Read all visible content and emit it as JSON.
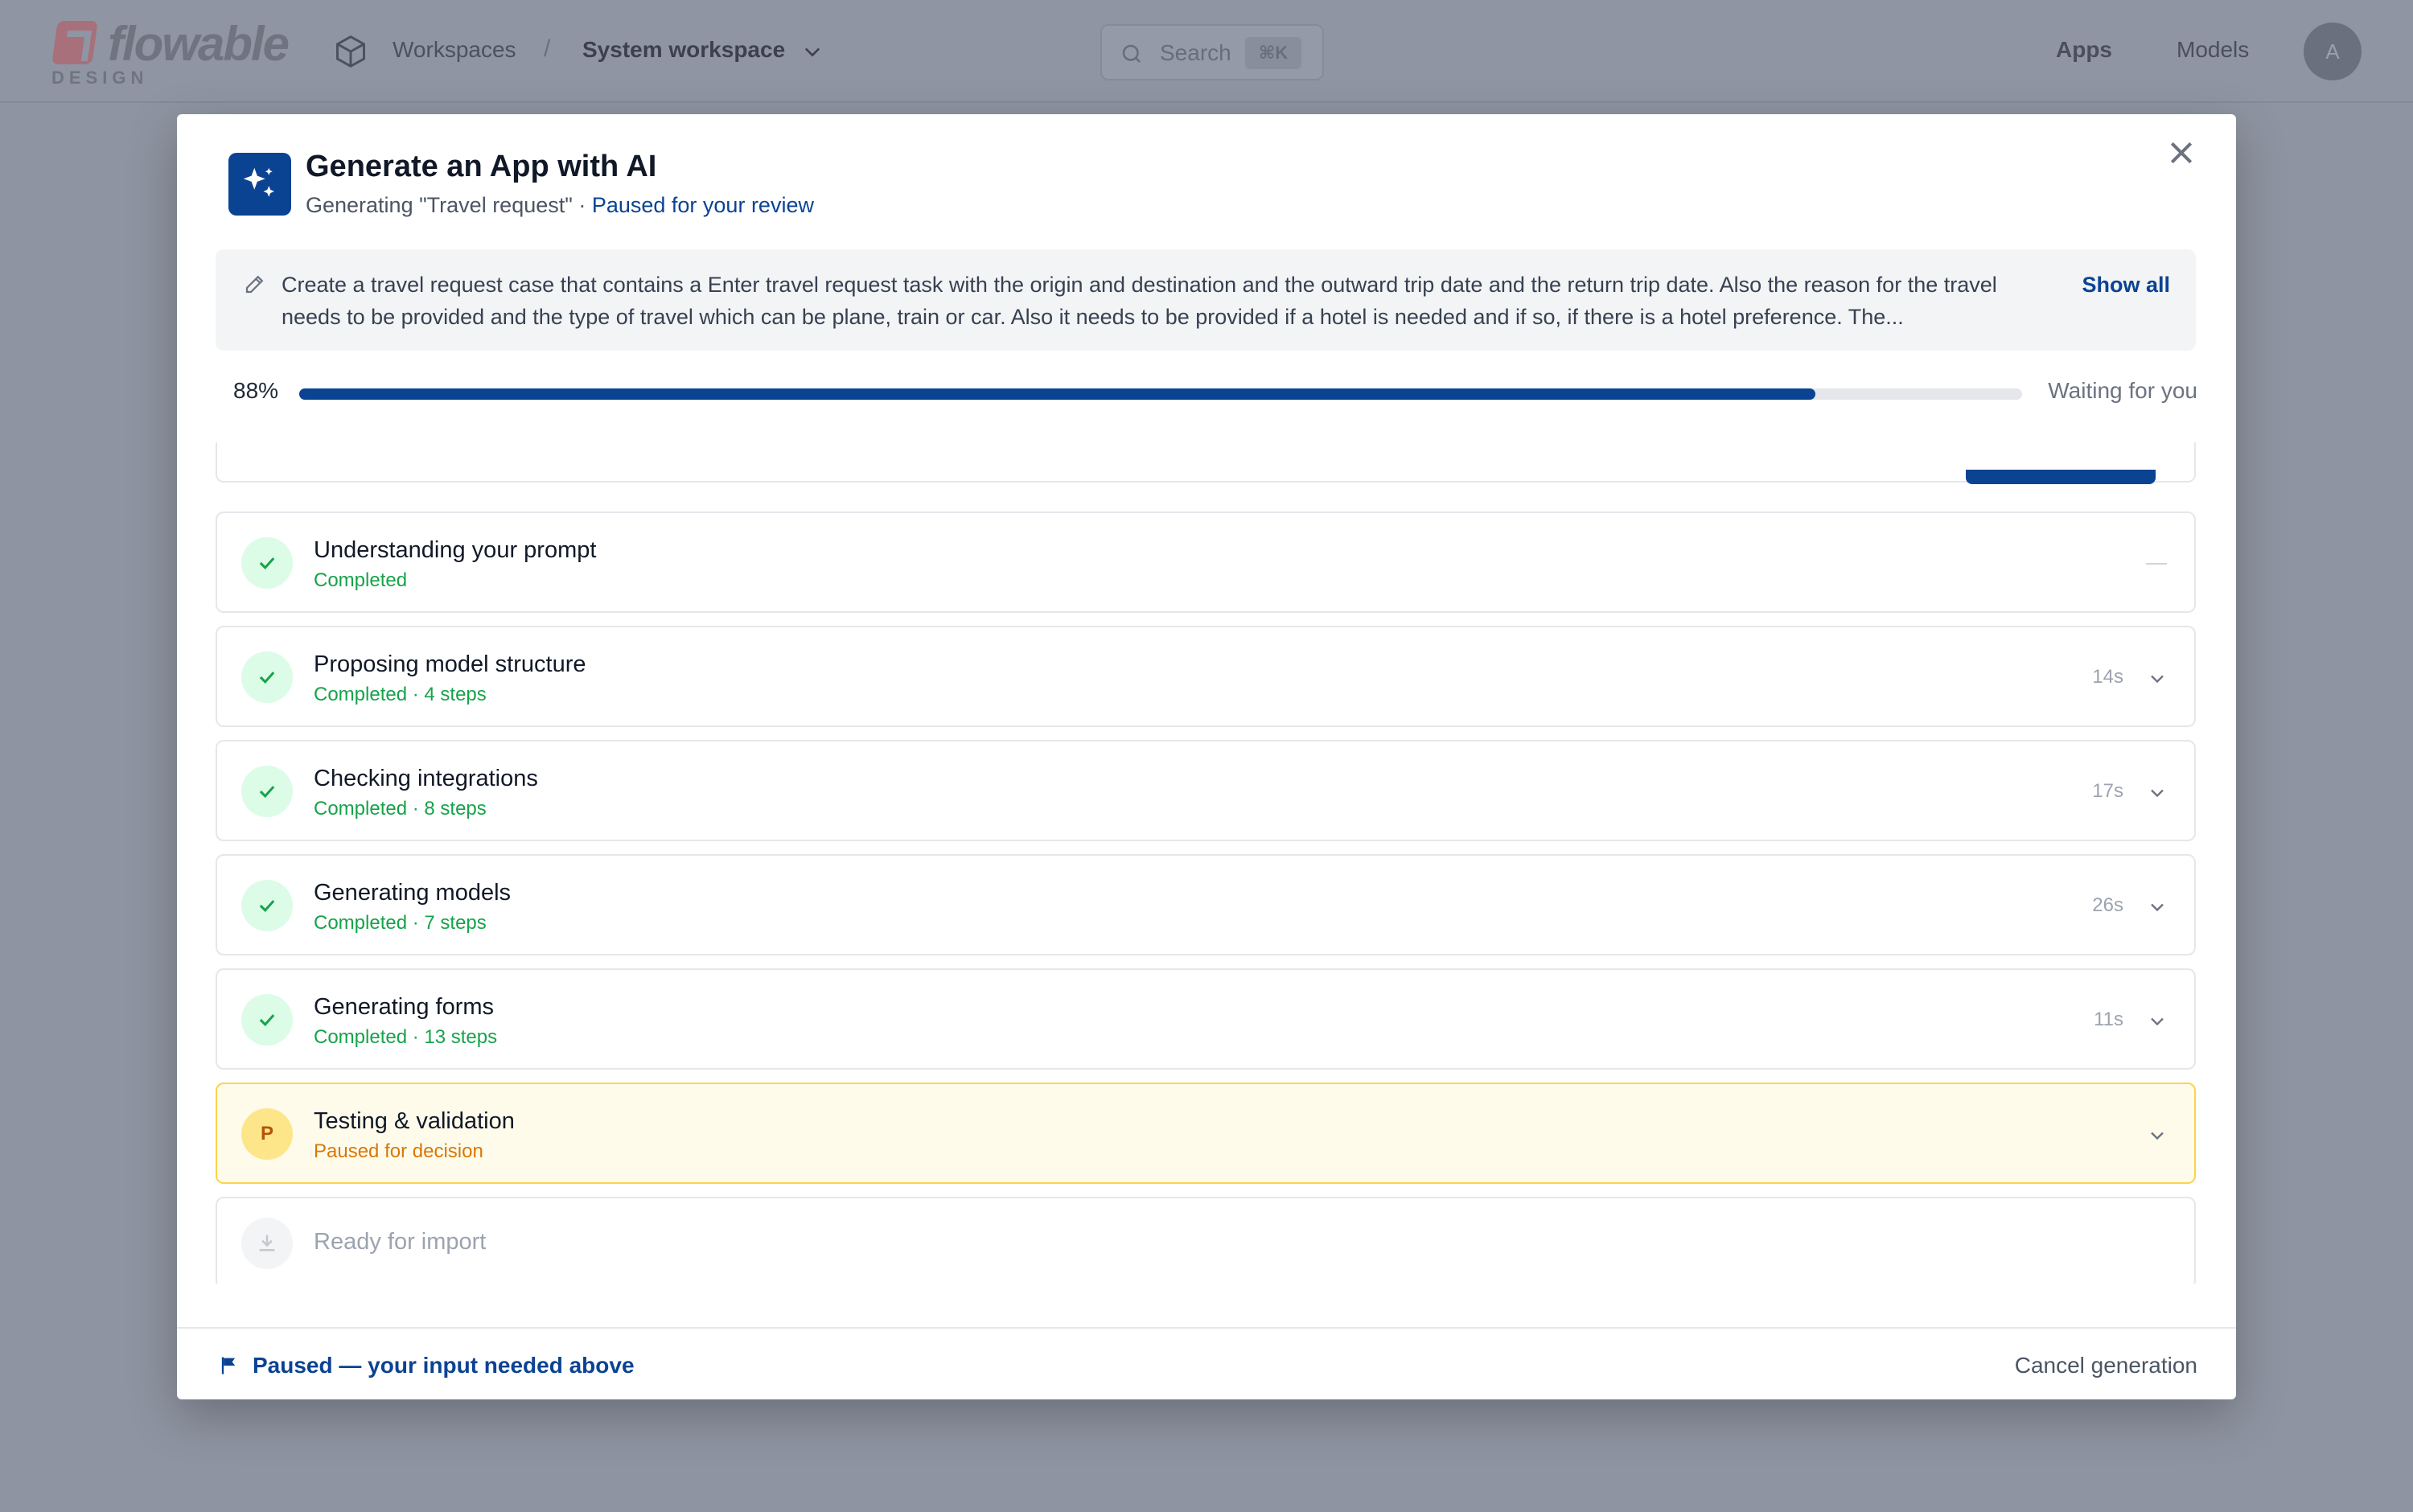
{
  "topbar": {
    "logo_text": "flowable",
    "logo_sub": "DESIGN",
    "breadcrumb_root": "Workspaces",
    "breadcrumb_sep": "/",
    "breadcrumb_current": "System workspace",
    "search_placeholder": "Search",
    "search_shortcut": "⌘K",
    "nav_apps": "Apps",
    "nav_models": "Models",
    "avatar_initial": "A"
  },
  "modal": {
    "title": "Generate an App with AI",
    "subtitle_prefix": "Generating \"Travel request\" · ",
    "subtitle_status": "Paused for your review",
    "prompt": "Create a travel request case that contains a Enter travel request task with the origin and destination and the outward trip date and the return trip date. Also the reason for the travel needs to be provided and the type of travel which can be plane, train or car. Also it needs to be provided if a hotel is needed and if so, if there is a hotel preference. The...",
    "show_all": "Show all",
    "progress_label": "88%",
    "progress_value": 0.88,
    "waiting_label": "Waiting for you",
    "steps": [
      {
        "name": "Understanding your prompt",
        "status": "Completed",
        "time": ""
      },
      {
        "name": "Proposing model structure",
        "status": "Completed · 4 steps",
        "time": "14s"
      },
      {
        "name": "Checking integrations",
        "status": "Completed · 8 steps",
        "time": "17s"
      },
      {
        "name": "Generating models",
        "status": "Completed · 7 steps",
        "time": "26s"
      },
      {
        "name": "Generating forms",
        "status": "Completed · 13 steps",
        "time": "11s"
      },
      {
        "name": "Testing & validation",
        "status": "Paused for decision",
        "time": "",
        "badge": "P"
      },
      {
        "name": "Ready for import",
        "status": "",
        "time": ""
      }
    ],
    "footer_message": "Paused — your input needed above",
    "cancel_label": "Cancel generation"
  },
  "colors": {
    "brand": "#0b4393",
    "success": "#16a34a",
    "warning": "#d97706"
  }
}
